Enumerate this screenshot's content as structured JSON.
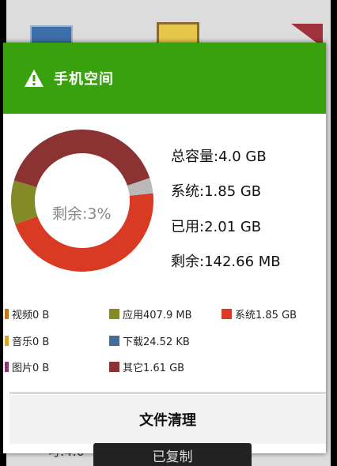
{
  "dialog": {
    "title": "手机空间",
    "action_label": "文件清理"
  },
  "donut": {
    "center_label": "剩余:3%",
    "segments": [
      {
        "name": "系统",
        "value": 1.85,
        "color": "#d93a23"
      },
      {
        "name": "应用",
        "value": 0.398,
        "color": "#848a26"
      },
      {
        "name": "其它",
        "value": 1.61,
        "color": "#8b3333"
      },
      {
        "name": "剩余",
        "value": 0.139,
        "color": "#b9b9b9"
      }
    ]
  },
  "stats": {
    "total": "总容量:4.0 GB",
    "system": "系统:1.85 GB",
    "used": "已用:2.01 GB",
    "free": "剩余:142.66 MB"
  },
  "legend": [
    {
      "label": "视频0 B",
      "color": "#c8741c"
    },
    {
      "label": "应用407.9 MB",
      "color": "#848a26"
    },
    {
      "label": "系统1.85 GB",
      "color": "#d93a23"
    },
    {
      "label": "音乐0 B",
      "color": "#e0a030"
    },
    {
      "label": "下载24.52 KB",
      "color": "#4a6a9a"
    },
    {
      "label": "图片0 B",
      "color": "#8b3a6b"
    },
    {
      "label": "其它1.61 GB",
      "color": "#8b3333"
    }
  ],
  "background": {
    "bottom_text": "可:4.0",
    "toast": "已复制"
  },
  "colors": {
    "header": "#3aa10e"
  }
}
